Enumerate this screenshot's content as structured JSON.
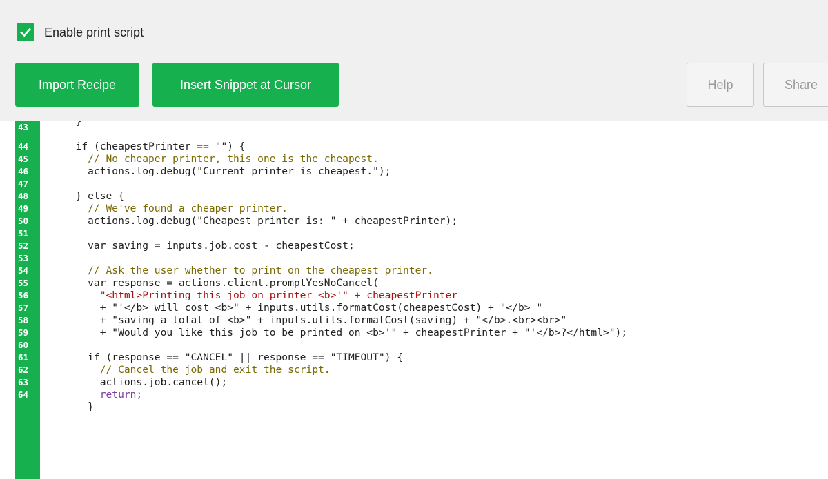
{
  "enable": {
    "label": "Enable print script",
    "checked": true
  },
  "toolbar": {
    "import_label": "Import Recipe",
    "insert_label": "Insert Snippet at Cursor",
    "help_label": "Help",
    "share_label": "Share"
  },
  "colors": {
    "accent": "#16b04f",
    "keyword": "#7a3e9d",
    "string": "#a31515",
    "comment": "#7a6a00",
    "identifier": "#1a4d9e"
  },
  "editor": {
    "line_numbers": [
      "43",
      "44",
      "45",
      "46",
      "47",
      "48",
      "49",
      "50",
      "51",
      "52",
      "53",
      "54",
      "55",
      "56",
      "57",
      "58",
      "59",
      "60",
      "61",
      "62",
      "63",
      "64"
    ],
    "lines": [
      "  }",
      "  if (cheapestPrinter == \"\") {",
      "    // No cheaper printer, this one is the cheapest.",
      "    actions.log.debug(\"Current printer is cheapest.\");",
      "",
      "  } else {",
      "    // We've found a cheaper printer.",
      "    actions.log.debug(\"Cheapest printer is: \" + cheapestPrinter);",
      "",
      "    var saving = inputs.job.cost - cheapestCost;",
      "",
      "    // Ask the user whether to print on the cheapest printer.",
      "    var response = actions.client.promptYesNoCancel(",
      "      \"<html>Printing this job on printer <b>'\" + cheapestPrinter",
      "      + \"'</b> will cost <b>\" + inputs.utils.formatCost(cheapestCost) + \"</b> \"",
      "      + \"saving a total of <b>\" + inputs.utils.formatCost(saving) + \"</b>.<br><br>\"",
      "      + \"Would you like this job to be printed on <b>'\" + cheapestPrinter + \"'</b>?</html>\");",
      "",
      "    if (response == \"CANCEL\" || response == \"TIMEOUT\") {",
      "      // Cancel the job and exit the script.",
      "      actions.job.cancel();",
      "      return;",
      "    }"
    ]
  }
}
